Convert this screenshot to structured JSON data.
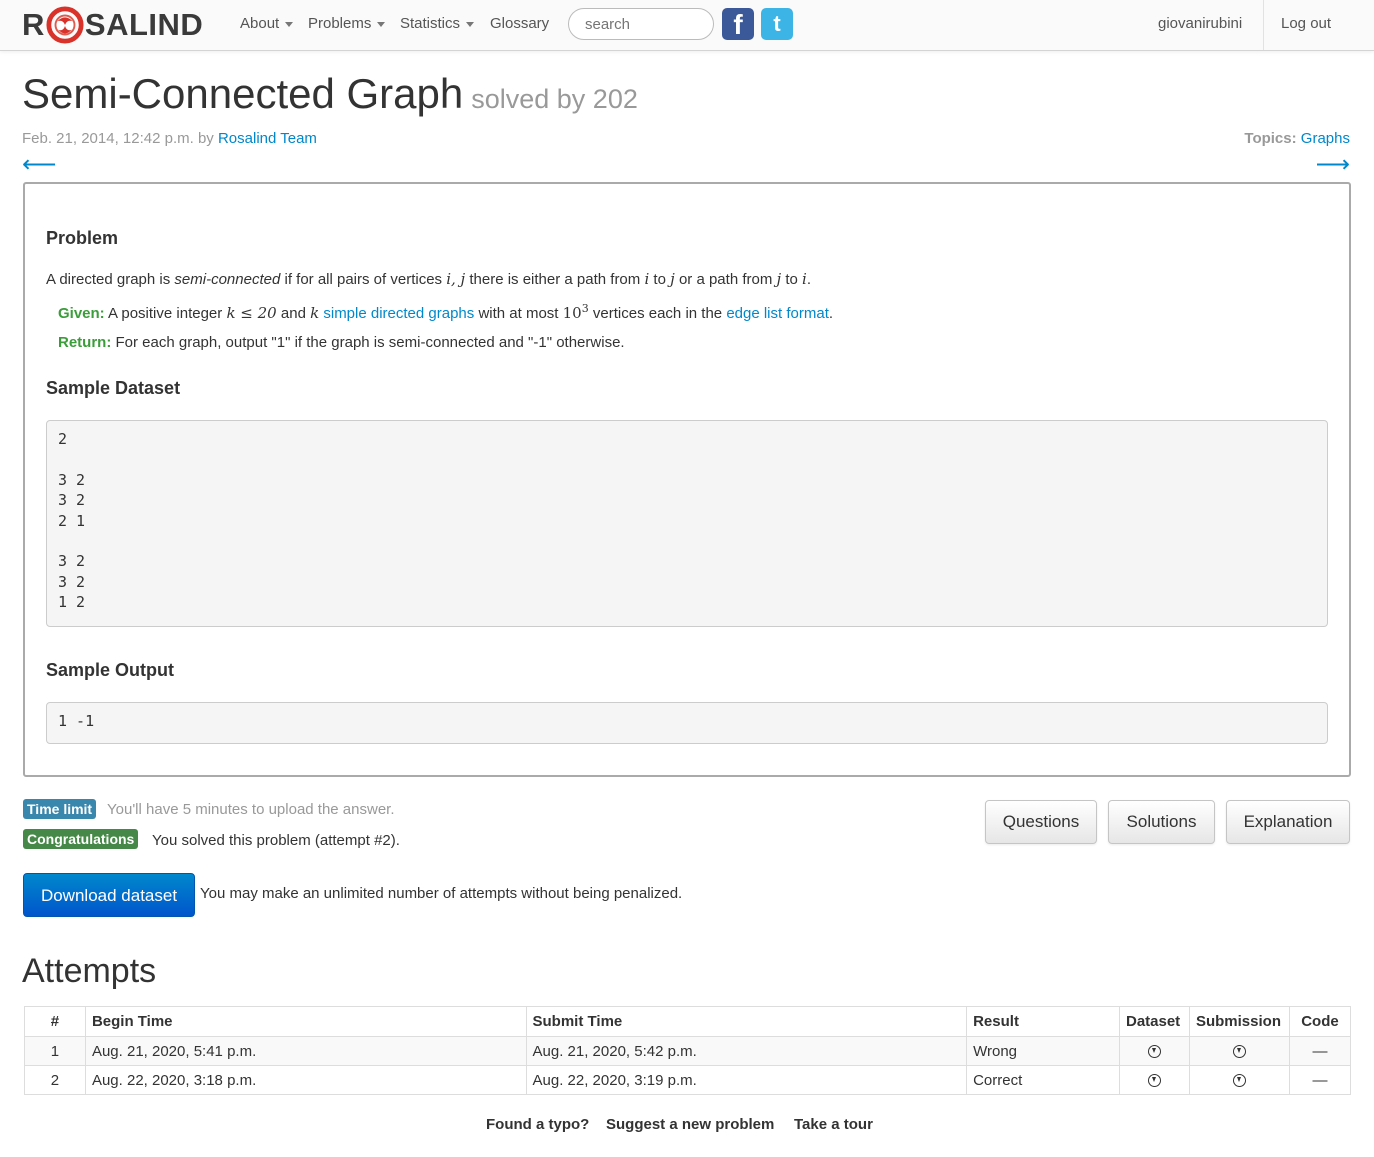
{
  "nav": {
    "logo_left": "R",
    "logo_right": "SALIND",
    "items": [
      {
        "label": "About",
        "dropdown": true
      },
      {
        "label": "Problems",
        "dropdown": true
      },
      {
        "label": "Statistics",
        "dropdown": true
      },
      {
        "label": "Glossary",
        "dropdown": false
      }
    ],
    "search_placeholder": "search",
    "facebook_glyph": "f",
    "twitter_glyph": "t",
    "user": "giovanirubini",
    "logout": "Log out"
  },
  "header": {
    "title": "Semi-Connected Graph",
    "solved_by": "solved by 202",
    "date": "Feb. 21, 2014, 12:42 p.m. by",
    "author": "Rosalind Team",
    "topics_label": "Topics:",
    "topics_value": "Graphs",
    "prev_arrow": "⟵",
    "next_arrow": "⟶"
  },
  "problem": {
    "heading": "Problem",
    "statement": {
      "t1": "A directed graph is ",
      "em": "semi-connected",
      "t2": " if for all pairs of vertices ",
      "m1": "i, j",
      "t3": " there is either a path from ",
      "m2": "i",
      "t4": " to ",
      "m3": "j",
      "t5": " or a path from ",
      "m4": "j",
      "t6": " to ",
      "m5": "i",
      "t7": "."
    },
    "given": {
      "label": "Given:",
      "t1": " A positive integer ",
      "m1": "k ≤ 20",
      "t2": " and ",
      "m2": "k",
      "link1": "simple directed graphs",
      "t3": " with at most ",
      "m3_base": "10",
      "m3_exp": "3",
      "t4": " vertices each in the ",
      "link2": "edge list format",
      "t5": "."
    },
    "return": {
      "label": "Return:",
      "text": " For each graph, output \"1\" if the graph is semi-connected and \"-1\" otherwise."
    },
    "sample_dataset_heading": "Sample Dataset",
    "sample_dataset": "2\n\n3 2\n3 2\n2 1\n\n3 2\n3 2\n1 2",
    "sample_output_heading": "Sample Output",
    "sample_output": "1 -1"
  },
  "status": {
    "time_limit_label": "Time limit",
    "time_limit_text": "You'll have 5 minutes to upload the answer.",
    "congrats_label": "Congratulations",
    "congrats_text": "You solved this problem (attempt #2).",
    "download_button": "Download dataset",
    "download_note": "You may make an unlimited number of attempts without being penalized.",
    "colors": {
      "time_limit": "#3a87ad",
      "congrats": "#468847",
      "primary": "#0088cc"
    }
  },
  "buttons": {
    "questions": "Questions",
    "solutions": "Solutions",
    "explanation": "Explanation"
  },
  "attempts": {
    "heading": "Attempts",
    "columns": [
      "#",
      "Begin Time",
      "Submit Time",
      "Result",
      "Dataset",
      "Submission",
      "Code"
    ],
    "rows": [
      {
        "n": "1",
        "begin": "Aug. 21, 2020, 5:41 p.m.",
        "submit": "Aug. 21, 2020, 5:42 p.m.",
        "result": "Wrong",
        "dataset_icon": "download-icon",
        "submission_icon": "download-icon",
        "code": "—"
      },
      {
        "n": "2",
        "begin": "Aug. 22, 2020, 3:18 p.m.",
        "submit": "Aug. 22, 2020, 3:19 p.m.",
        "result": "Correct",
        "dataset_icon": "download-icon",
        "submission_icon": "download-icon",
        "code": "—"
      }
    ]
  },
  "footer": {
    "typo": "Found a typo?",
    "suggest": "Suggest a new problem",
    "tour": "Take a tour"
  }
}
